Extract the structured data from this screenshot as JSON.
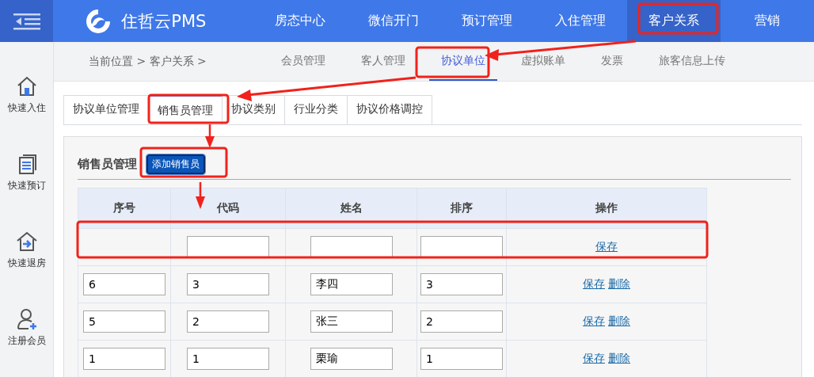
{
  "brand": {
    "name": "住哲云PMS"
  },
  "nav": [
    {
      "label": "房态中心",
      "selected": false
    },
    {
      "label": "微信开门",
      "selected": false
    },
    {
      "label": "预订管理",
      "selected": false
    },
    {
      "label": "入住管理",
      "selected": false
    },
    {
      "label": "客户关系",
      "selected": true
    },
    {
      "label": "营销",
      "selected": false
    }
  ],
  "sidebar": {
    "items": [
      {
        "kind": "checkin",
        "label": "快速入住"
      },
      {
        "kind": "booking",
        "label": "快速预订"
      },
      {
        "kind": "checkout",
        "label": "快速退房"
      },
      {
        "kind": "member",
        "label": "注册会员"
      }
    ]
  },
  "breadcrumb": "当前位置 > 客户关系 >",
  "subnav": [
    {
      "label": "会员管理",
      "selected": false
    },
    {
      "label": "客人管理",
      "selected": false
    },
    {
      "label": "协议单位",
      "selected": true
    },
    {
      "label": "虚拟账单",
      "selected": false
    },
    {
      "label": "发票",
      "selected": false
    },
    {
      "label": "旅客信息上传",
      "selected": false
    }
  ],
  "tabs": [
    {
      "label": "协议单位管理",
      "selected": false
    },
    {
      "label": "销售员管理",
      "selected": true
    },
    {
      "label": "协议类别",
      "selected": false
    },
    {
      "label": "行业分类",
      "selected": false
    },
    {
      "label": "协议价格调控",
      "selected": false
    }
  ],
  "panel": {
    "title": "销售员管理",
    "add_button": "添加销售员"
  },
  "table": {
    "columns": [
      "序号",
      "代码",
      "姓名",
      "排序",
      "操作"
    ],
    "rows": [
      {
        "kind": "new",
        "actions": [
          "保存"
        ]
      },
      {
        "kind": "existing",
        "seq": "6",
        "code": "3",
        "name": "李四",
        "sort": "3",
        "actions": [
          "保存",
          "删除"
        ]
      },
      {
        "kind": "existing",
        "seq": "5",
        "code": "2",
        "name": "张三",
        "sort": "2",
        "actions": [
          "保存",
          "删除"
        ]
      },
      {
        "kind": "existing",
        "seq": "1",
        "code": "1",
        "name": "栗瑜",
        "sort": "1",
        "actions": [
          "保存",
          "删除"
        ]
      }
    ]
  }
}
